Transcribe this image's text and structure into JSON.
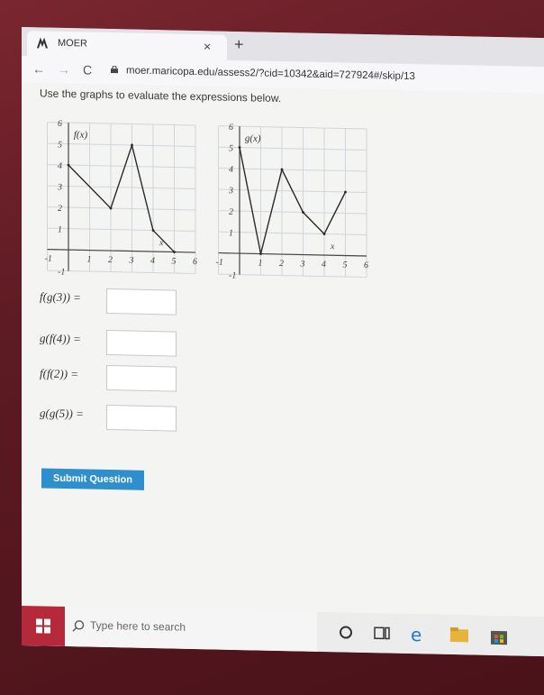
{
  "browser": {
    "tab_title": "MOER",
    "url": "moer.maricopa.edu/assess2/?cid=10342&aid=727924#/skip/13"
  },
  "instructions": "Use the graphs to evaluate the expressions below.",
  "graphs": {
    "f": {
      "label": "f(x)",
      "x_axis_label": "x"
    },
    "g": {
      "label": "g(x)",
      "x_axis_label": "x"
    }
  },
  "chart_data": [
    {
      "type": "line",
      "label": "f(x)",
      "x": [
        0,
        2,
        3,
        4,
        5
      ],
      "y": [
        4,
        2,
        5,
        1,
        0
      ],
      "xlim": [
        -1,
        6
      ],
      "ylim": [
        -1,
        6
      ],
      "x_ticks": [
        "-1",
        "1",
        "2",
        "3",
        "4",
        "5",
        "6"
      ],
      "y_ticks": [
        "-1",
        "1",
        "2",
        "3",
        "4",
        "5",
        "6"
      ],
      "grid": true
    },
    {
      "type": "line",
      "label": "g(x)",
      "x": [
        0,
        1,
        2,
        3,
        4,
        5
      ],
      "y": [
        5,
        0,
        4,
        2,
        1,
        3
      ],
      "xlim": [
        -1,
        6
      ],
      "ylim": [
        -1,
        6
      ],
      "x_ticks": [
        "-1",
        "1",
        "2",
        "3",
        "4",
        "5",
        "6"
      ],
      "y_ticks": [
        "-1",
        "1",
        "2",
        "3",
        "4",
        "5",
        "6"
      ],
      "grid": true
    }
  ],
  "questions": [
    {
      "expr": "f(g(3)) =",
      "answer": ""
    },
    {
      "expr": "g(f(4)) =",
      "answer": ""
    },
    {
      "expr": "f(f(2)) =",
      "answer": ""
    },
    {
      "expr": "g(g(5)) =",
      "answer": ""
    }
  ],
  "submit_label": "Submit Question",
  "taskbar": {
    "search_placeholder": "Type here to search"
  }
}
